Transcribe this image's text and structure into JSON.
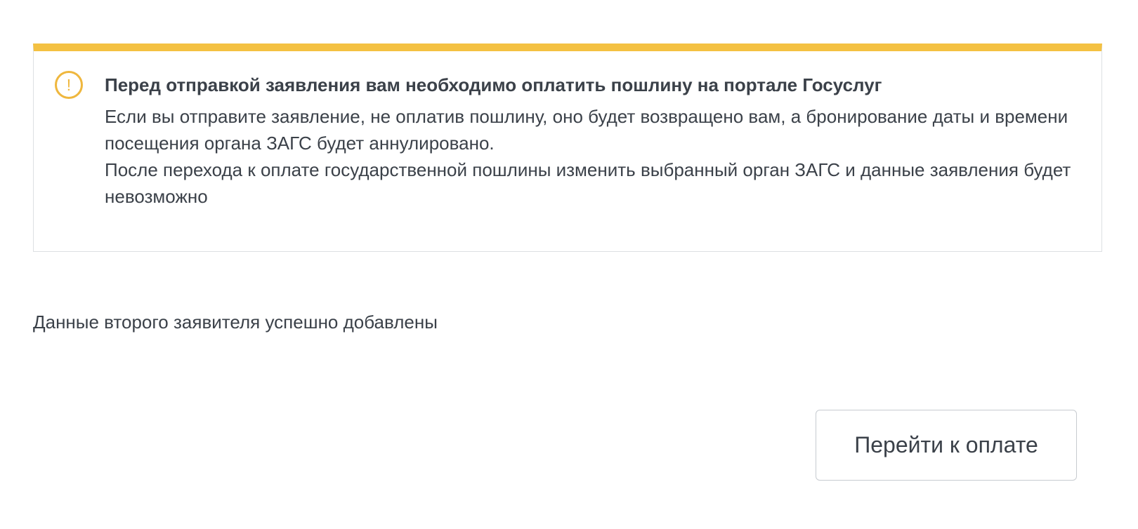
{
  "notice": {
    "icon": "exclamation-circle-icon",
    "icon_symbol": "!",
    "accent_color": "#f4c142",
    "icon_color": "#efb73e",
    "title": "Перед отправкой заявления вам необходимо оплатить пошлину на портале Госуслуг",
    "paragraph_1": "Если вы отправите заявление, не оплатив пошлину, оно будет возвращено вам, а бронирование даты и времени посещения органа ЗАГС будет аннулировано.",
    "paragraph_2": "После перехода к оплате государственной пошлины изменить выбранный орган ЗАГС и данные заявления будет невозможно"
  },
  "status": {
    "message": "Данные второго заявителя успешно добавлены"
  },
  "actions": {
    "pay_label": "Перейти к оплате"
  }
}
